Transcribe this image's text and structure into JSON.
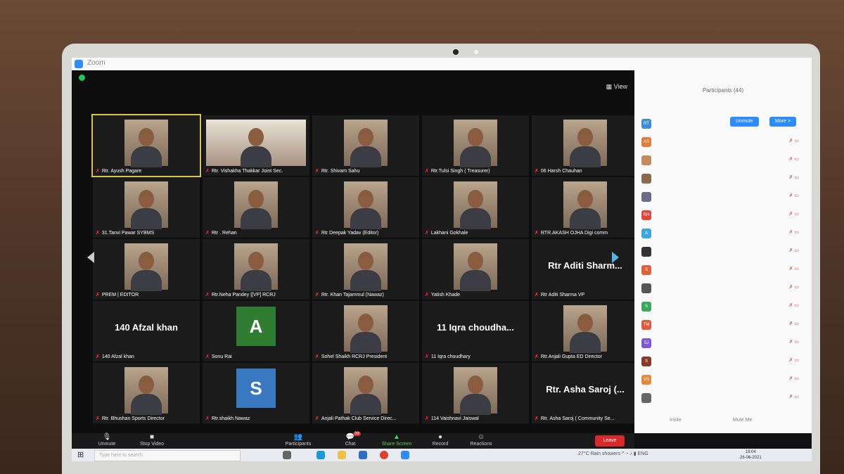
{
  "window": {
    "title": "Zoom"
  },
  "view_label": "View",
  "tiles": [
    {
      "label": "Rtr. Ayush Pagare",
      "type": "video",
      "active": true
    },
    {
      "label": "Rtr. Vishakha Thakkar Joint Sec.",
      "type": "video-wide"
    },
    {
      "label": "Rtr. Shivam Sahu",
      "type": "video"
    },
    {
      "label": "Rtr.Tulsi Singh ( Treasurer)",
      "type": "video"
    },
    {
      "label": "06 Harsh Chauhan",
      "type": "video"
    },
    {
      "label": "31.Tanvi Pawar SYBMS",
      "type": "video"
    },
    {
      "label": "Rtr . Rehan",
      "type": "video"
    },
    {
      "label": "Rtr Deepak Yadav (Editor)",
      "type": "video"
    },
    {
      "label": "Lakhani Gokhale",
      "type": "video"
    },
    {
      "label": "RTR.AKASH OJHA Digi comm",
      "type": "video"
    },
    {
      "label": "PREM | EDITOR",
      "type": "video"
    },
    {
      "label": "Rtr.Neha Pandey |[VP] RCRJ",
      "type": "video"
    },
    {
      "label": "Rtr. Khan Tajammul (Nawaz)",
      "type": "video"
    },
    {
      "label": "Yatish Khade",
      "type": "video"
    },
    {
      "label": "Rtr Aditi Sharma VP",
      "type": "name",
      "bigname": "Rtr Aditi Sharm..."
    },
    {
      "label": "140 Afzal khan",
      "type": "name",
      "bigname": "140 Afzal khan"
    },
    {
      "label": "Sonu Rai",
      "type": "avatar",
      "letter": "A",
      "color": "#2e7d32"
    },
    {
      "label": "Sohel Shaikh RCRJ President",
      "type": "video"
    },
    {
      "label": "11 Iqra choudhary",
      "type": "name",
      "bigname": "11 Iqra choudha..."
    },
    {
      "label": "Rtr.Anjali Gupta ED Director",
      "type": "video"
    },
    {
      "label": "Rtr. Bhushan Sports Director",
      "type": "video"
    },
    {
      "label": "Rtr.shaikh Nawaz",
      "type": "avatar",
      "letter": "S",
      "color": "#3a78c2"
    },
    {
      "label": "Anjali Pathak Club Service Direc...",
      "type": "video"
    },
    {
      "label": "114 Vaishnavi Jaiswal",
      "type": "video"
    },
    {
      "label": "Rtr. Asha Saroj ( Community Se...",
      "type": "name",
      "bigname": "Rtr. Asha Saroj (..."
    }
  ],
  "toolbar": {
    "unmute": "Unmute",
    "stop_video": "Stop Video",
    "participants": "Participants",
    "participants_count": "44",
    "chat": "Chat",
    "chat_badge": "39",
    "share_screen": "Share Screen",
    "record": "Record",
    "reactions": "Reactions",
    "end": "Leave"
  },
  "panel": {
    "title": "Participants (44)",
    "unmute_button": "Unmute",
    "more_button": "More >",
    "invite": "Invite",
    "mute_all": "Mute Me",
    "avatars": [
      {
        "initials": "RT",
        "color": "#3a8fd8"
      },
      {
        "initials": "AS",
        "color": "#e07b3a"
      },
      {
        "initials": "",
        "color": "#c58a5c"
      },
      {
        "initials": "",
        "color": "#8b6a4e"
      },
      {
        "initials": "",
        "color": "#6a6a8a"
      },
      {
        "initials": "RH",
        "color": "#e0483a"
      },
      {
        "initials": "A",
        "color": "#3aa8d8"
      },
      {
        "initials": "",
        "color": "#333333"
      },
      {
        "initials": "S",
        "color": "#e0603a"
      },
      {
        "initials": "",
        "color": "#555555"
      },
      {
        "initials": "S",
        "color": "#3aa85a"
      },
      {
        "initials": "TM",
        "color": "#e05a3a"
      },
      {
        "initials": "SJ",
        "color": "#7a5ad8"
      },
      {
        "initials": "S",
        "color": "#8a3a2a"
      },
      {
        "initials": "VS",
        "color": "#e08a3a"
      },
      {
        "initials": "",
        "color": "#666666"
      }
    ]
  },
  "taskbar": {
    "search_placeholder": "Type here to search",
    "tray_text": "27°C Rain showers",
    "lang": "ENG",
    "time": "19:04",
    "date": "26-06-2021"
  }
}
